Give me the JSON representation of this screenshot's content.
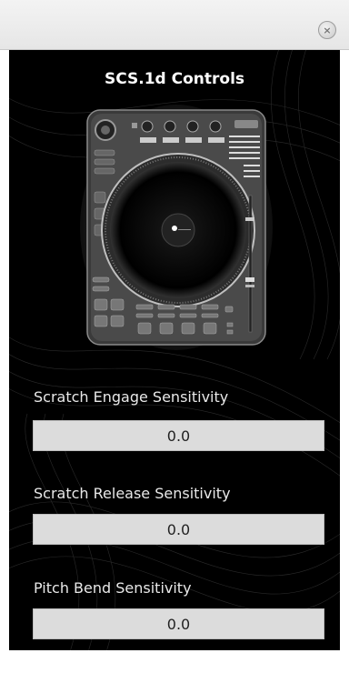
{
  "window": {
    "close_icon": "close-icon"
  },
  "panel": {
    "title": "SCS.1d Controls",
    "device_image": "turntable-controller-image",
    "fields": [
      {
        "label": "Scratch Engage Sensitivity",
        "value": "0.0"
      },
      {
        "label": "Scratch Release Sensitivity",
        "value": "0.0"
      },
      {
        "label": "Pitch Bend Sensitivity",
        "value": "0.0"
      }
    ]
  },
  "colors": {
    "panel_bg": "#000000",
    "field_bg": "#dcdcdc",
    "label_text": "#e8e8e8"
  }
}
